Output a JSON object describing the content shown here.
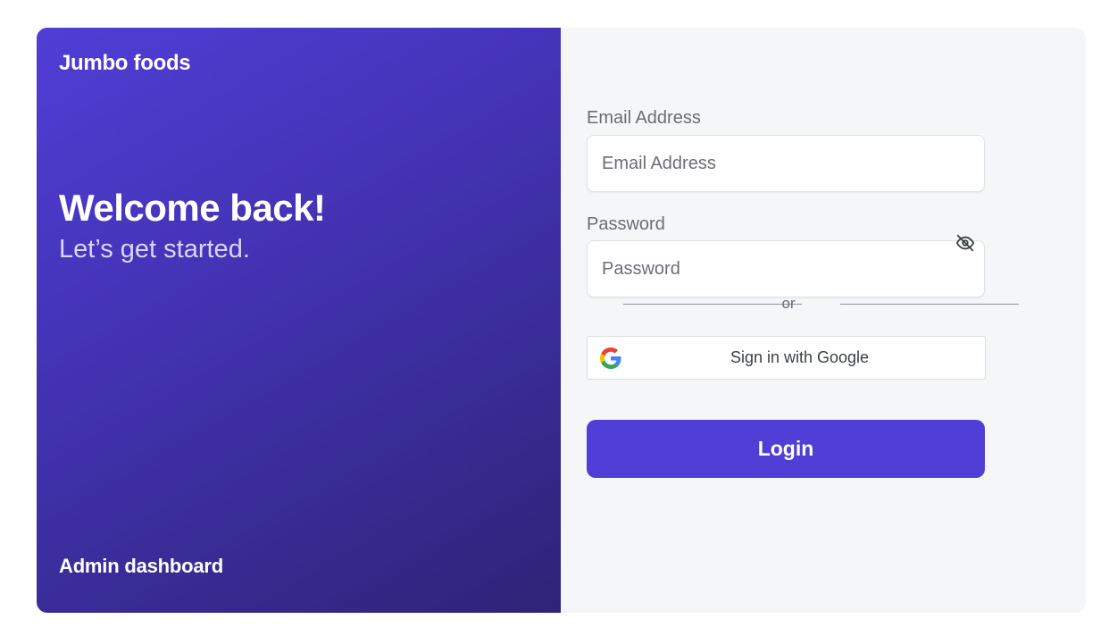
{
  "hero": {
    "brand": "Jumbo foods",
    "title": "Welcome back!",
    "subtitle": "Let’s get started.",
    "footer": "Admin dashboard"
  },
  "form": {
    "email": {
      "label": "Email Address",
      "placeholder": "Email Address",
      "value": ""
    },
    "password": {
      "label": "Password",
      "placeholder": "Password",
      "value": "",
      "toggle_icon": "eye-off-icon"
    },
    "divider_text": "or",
    "google_button": {
      "label": "Sign in with Google",
      "icon": "google-logo-icon"
    },
    "login_button": {
      "label": "Login"
    }
  },
  "colors": {
    "brand_primary": "#503ed6",
    "gradient_end": "#2e2376",
    "panel_background": "#f5f6f8",
    "muted_text": "#6b6e75"
  }
}
